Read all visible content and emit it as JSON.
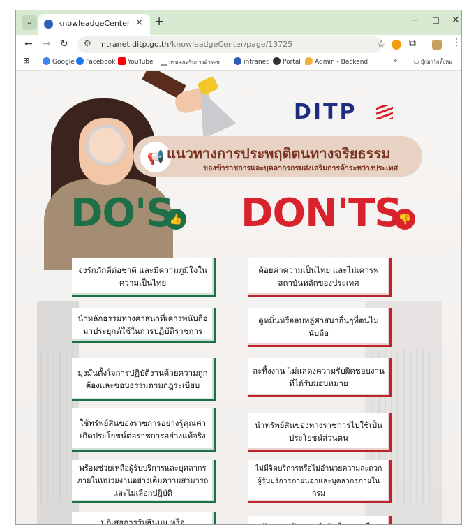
{
  "browser": {
    "tab_title": "knowleadgeCenter",
    "new_tab": "+",
    "tab_close": "×",
    "url_domain": "intranet.ditp.go.th",
    "url_path": "/knowleadgeCenter/page/13725",
    "window_controls": {
      "minimize": "−",
      "maximize": "☐",
      "close": "✕"
    }
  },
  "bookmarks": [
    {
      "label": "Google",
      "color": "#4285f4"
    },
    {
      "label": "Facebook",
      "color": "#1877f2"
    },
    {
      "label": "YouTube",
      "color": "#ff0000"
    },
    {
      "label": "กรมส่งเสริมการค้าระห...",
      "color": "#777777"
    },
    {
      "label": "intranet",
      "color": "#2b5fb8"
    },
    {
      "label": "Portal",
      "color": "#333333"
    },
    {
      "label": "Admin - Backend",
      "color": "#f2b134"
    }
  ],
  "bookmarks_overflow": "»",
  "bookmarks_folder": "บุ๊กมาร์กทั้งหม",
  "poster": {
    "logo": "DITP",
    "title": "แนวทางการประพฤติตนทางจริยธรรม",
    "subtitle": "ของข้าราชการและบุคลากรกรมส่งเสริมการค้าระหว่างประเทศ",
    "dos_heading": "DO'S",
    "donts_heading": "DON'TS",
    "dos": [
      "จงรักภักดีต่อชาติ และมีความภูมิใจในความเป็นไทย",
      "นำหลักธรรมทางศาสนาที่เคารพนับถือมาประยุกต์ใช้ในการปฏิบัติราชการ",
      "มุ่งมั่นตั้งใจการปฏิบัติงานด้วยความถูกต้องและชอบธรรมตามกฎระเบียบ",
      "ใช้ทรัพย์สินของราชการอย่างรู้คุณค่า เกิดประโยชน์ต่อราชการอย่างแท้จริง",
      "พร้อมช่วยเหลือผู้รับบริการและบุคลากรภายในหน่วยงานอย่างเต็มความสามารถ และไม่เลือกปฏิบัติ",
      "ปฏิเสธการรับสินบน หรือ"
    ],
    "donts": [
      "ด้อยค่าความเป็นไทย และไม่เคารพสถาบันหลักของประเทศ",
      "ดูหมิ่นหรือลบหลู่ศาสนาอื่นๆที่ตนไม่นับถือ",
      "ละทิ้งงาน ไม่แสดงความรับผิดชอบงานที่ได้รับมอบหมาย",
      "นำทรัพย์สินของทางราชการไปใช้เป็นประโยชน์ส่วนตน",
      "ไม่มีจิตบริการหรือไม่อำนวยความสะดวกผู้รับบริการภายนอกและบุคลากรภายในกรม",
      "รับของขวัญของกำนัลที่นอกเหนือ"
    ]
  },
  "colors": {
    "dos_green": "#1c6f46",
    "donts_red": "#d9232c",
    "title_brown": "#7a3424",
    "tab_bar": "#d9ead3"
  }
}
